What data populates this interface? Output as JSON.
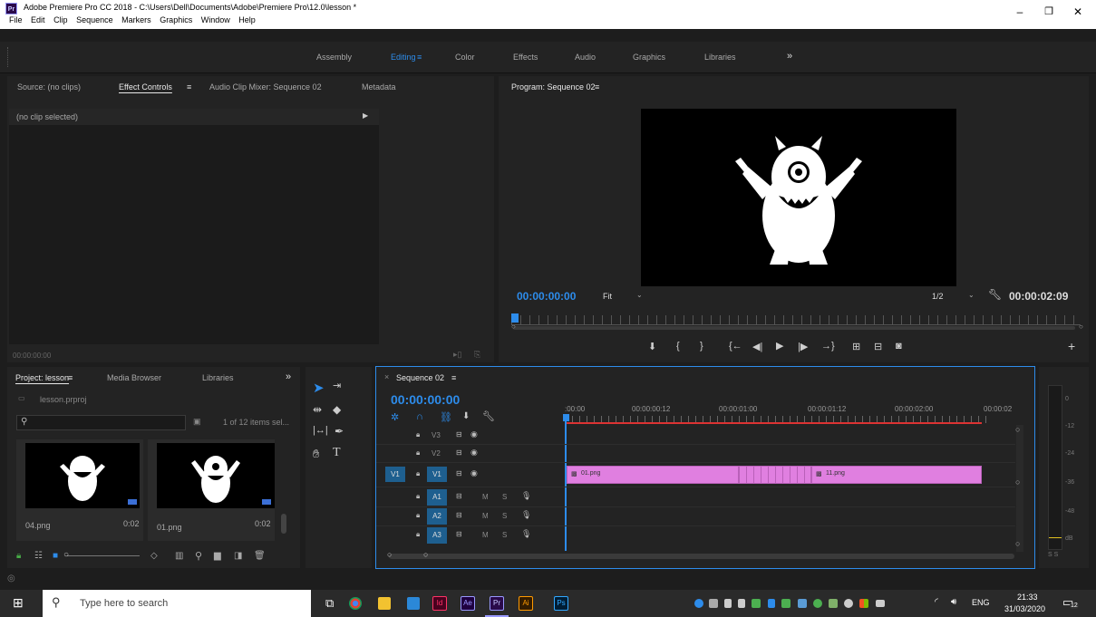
{
  "app": {
    "logo_text": "Pr",
    "window_title": "Adobe Premiere Pro CC 2018 - C:\\Users\\Dell\\Documents\\Adobe\\Premiere Pro\\12.0\\lesson *",
    "menu": [
      "File",
      "Edit",
      "Clip",
      "Sequence",
      "Markers",
      "Graphics",
      "Window",
      "Help"
    ],
    "minimize_glyph": "–",
    "restore_glyph": "❐",
    "close_glyph": "✕"
  },
  "workspaces": {
    "items": [
      "Assembly",
      "Editing",
      "Color",
      "Effects",
      "Audio",
      "Graphics",
      "Libraries"
    ],
    "active": "Editing",
    "menu_glyph": "≡",
    "overflow": "»"
  },
  "source_panel": {
    "tabs": [
      "Source: (no clips)",
      "Effect Controls",
      "Audio Clip Mixer: Sequence 02",
      "Metadata"
    ],
    "active_tab": "Effect Controls",
    "menu_glyph": "≡",
    "no_clip": "(no clip selected)",
    "timecode": "00:00:00:00"
  },
  "program_monitor": {
    "title": "Program: Sequence 02",
    "menu_glyph": "≡",
    "timecode": "00:00:00:00",
    "fit": "Fit",
    "resolution": "1/2",
    "duration": "00:00:02:09"
  },
  "project_panel": {
    "tabs": [
      "Project: lesson",
      "Media Browser",
      "Libraries"
    ],
    "menu_glyph": "≡",
    "overflow": "»",
    "project_file": "lesson.prproj",
    "item_count": "1 of 12 items sel...",
    "clips": [
      {
        "name": "04.png",
        "duration": "0:02"
      },
      {
        "name": "01.png",
        "duration": "0:02"
      }
    ]
  },
  "timeline": {
    "tab": "Sequence 02",
    "close_glyph": "×",
    "menu_glyph": "≡",
    "timecode": "00:00:00:00",
    "ruler": [
      ":00:00",
      "00:00:00:12",
      "00:00:01:00",
      "00:00:01:12",
      "00:00:02:00",
      "00:00:02"
    ],
    "video_tracks": [
      "V3",
      "V2",
      "V1"
    ],
    "audio_tracks": [
      "A1",
      "A2",
      "A3"
    ],
    "source_patch": "V1",
    "mute": "M",
    "solo": "S",
    "clips": [
      {
        "label": "01.png"
      },
      {
        "label": "11.png"
      }
    ]
  },
  "audio_meter": {
    "scale": [
      "0",
      "-12",
      "-24",
      "-36",
      "-48",
      "dB"
    ],
    "solo_labels": "S S"
  },
  "taskbar": {
    "search_placeholder": "Type here to search",
    "apps": [
      "Id",
      "Ae",
      "Pr",
      "Ai",
      "Ps"
    ],
    "language": "ENG",
    "time": "21:33",
    "date": "31/03/2020",
    "notification_count": "12"
  },
  "colors": {
    "accent_blue": "#2d8ceb",
    "clip_pink": "#e07fe0",
    "panel_bg": "#232323",
    "app_bg": "#1d1d1d"
  }
}
